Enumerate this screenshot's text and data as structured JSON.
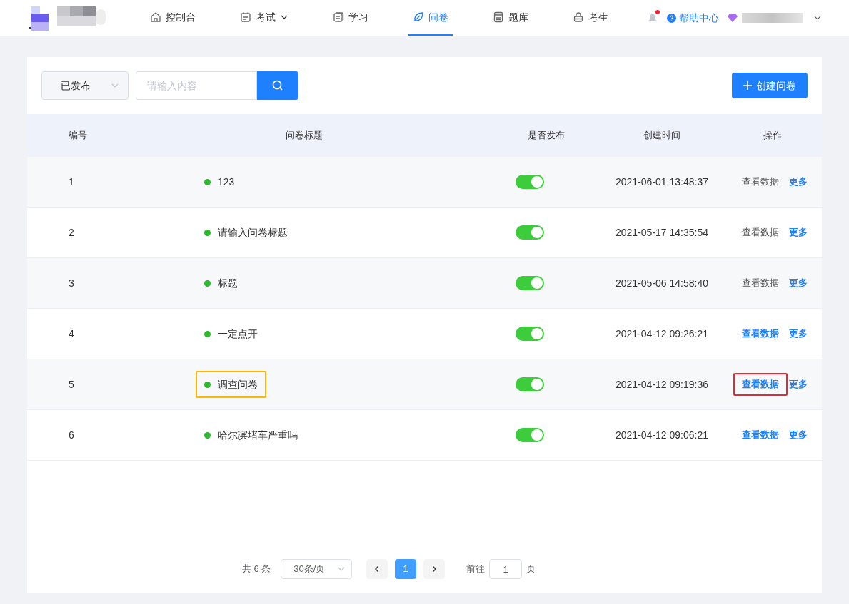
{
  "nav": {
    "items": [
      {
        "label": "控制台",
        "selected": false,
        "dropdown": false
      },
      {
        "label": "考试",
        "selected": false,
        "dropdown": true
      },
      {
        "label": "学习",
        "selected": false,
        "dropdown": false
      },
      {
        "label": "问卷",
        "selected": true,
        "dropdown": false
      },
      {
        "label": "题库",
        "selected": false,
        "dropdown": false
      },
      {
        "label": "考生",
        "selected": false,
        "dropdown": false
      }
    ],
    "notification_dot": true,
    "help": "帮助中心"
  },
  "filter": {
    "status": "已发布",
    "search_placeholder": "请输入内容",
    "create_button": "创建问卷"
  },
  "table": {
    "columns": [
      "编号",
      "问卷标题",
      "是否发布",
      "创建时间",
      "操作"
    ],
    "rows": [
      {
        "id": "1",
        "title": "123",
        "published": true,
        "created": "2021-06-01 13:48:37",
        "view": "查看数据",
        "more": "更多",
        "view_emphasized": false,
        "title_outlined": false,
        "view_outlined": false
      },
      {
        "id": "2",
        "title": "请输入问卷标题",
        "published": true,
        "created": "2021-05-17 14:35:54",
        "view": "查看数据",
        "more": "更多",
        "view_emphasized": false,
        "title_outlined": false,
        "view_outlined": false
      },
      {
        "id": "3",
        "title": "标题",
        "published": true,
        "created": "2021-05-06 14:58:40",
        "view": "查看数据",
        "more": "更多",
        "view_emphasized": false,
        "title_outlined": false,
        "view_outlined": false
      },
      {
        "id": "4",
        "title": "一定点开",
        "published": true,
        "created": "2021-04-12 09:26:21",
        "view": "查看数据",
        "more": "更多",
        "view_emphasized": true,
        "title_outlined": false,
        "view_outlined": false
      },
      {
        "id": "5",
        "title": "调查问卷",
        "published": true,
        "created": "2021-04-12 09:19:36",
        "view": "查看数据",
        "more": "更多",
        "view_emphasized": true,
        "title_outlined": true,
        "view_outlined": true
      },
      {
        "id": "6",
        "title": "哈尔滨堵车严重吗",
        "published": true,
        "created": "2021-04-12 09:06:21",
        "view": "查看数据",
        "more": "更多",
        "view_emphasized": true,
        "title_outlined": false,
        "view_outlined": false
      }
    ]
  },
  "pagination": {
    "total": "共 6 条",
    "page_size": "30条/页",
    "pages": [
      {
        "label": "1",
        "selected": true
      }
    ],
    "goto_label": "前往",
    "goto_value": "1",
    "goto_suffix": "页"
  }
}
